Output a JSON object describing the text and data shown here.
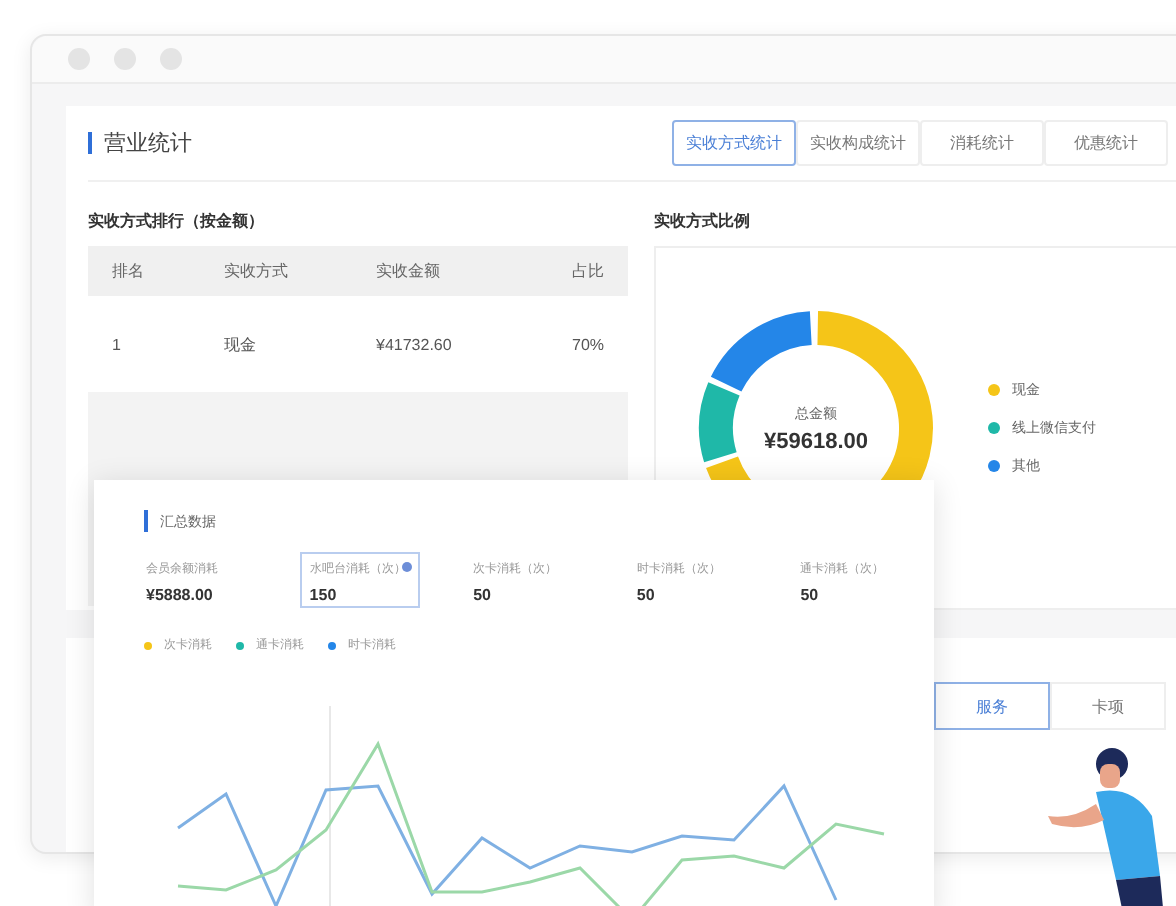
{
  "panel": {
    "title": "营业统计",
    "tabs": [
      {
        "label": "实收方式统计",
        "selected": true
      },
      {
        "label": "实收构成统计",
        "selected": false
      },
      {
        "label": "消耗统计",
        "selected": false
      },
      {
        "label": "优惠统计",
        "selected": false
      }
    ]
  },
  "ranking": {
    "title": "实收方式排行（按金额）",
    "columns": [
      "排名",
      "实收方式",
      "实收金额",
      "占比"
    ],
    "rows": [
      [
        "1",
        "现金",
        "¥41732.60",
        "70%"
      ]
    ]
  },
  "ratio": {
    "title": "实收方式比例",
    "center_label": "总金额",
    "center_value": "¥59618.00",
    "legend": [
      {
        "label": "现金",
        "color": "#f5c518"
      },
      {
        "label": "线上微信支付",
        "color": "#1fb8a8"
      },
      {
        "label": "其他",
        "color": "#2486e8"
      }
    ]
  },
  "lower_panel": {
    "buttons": [
      {
        "label": "服务",
        "selected": true
      },
      {
        "label": "卡项",
        "selected": false
      }
    ]
  },
  "summary": {
    "title": "汇总数据",
    "stats": [
      {
        "label": "会员余额消耗",
        "value": "¥5888.00",
        "selected": false
      },
      {
        "label": "水吧台消耗（次）",
        "value": "150",
        "selected": true
      },
      {
        "label": "次卡消耗（次）",
        "value": "50",
        "selected": false
      },
      {
        "label": "时卡消耗（次）",
        "value": "50",
        "selected": false
      },
      {
        "label": "通卡消耗（次）",
        "value": "50",
        "selected": false
      }
    ],
    "legend": [
      {
        "label": "次卡消耗",
        "color": "#f5c518"
      },
      {
        "label": "通卡消耗",
        "color": "#1fb8a8"
      },
      {
        "label": "时卡消耗",
        "color": "#2486e8"
      }
    ]
  }
}
